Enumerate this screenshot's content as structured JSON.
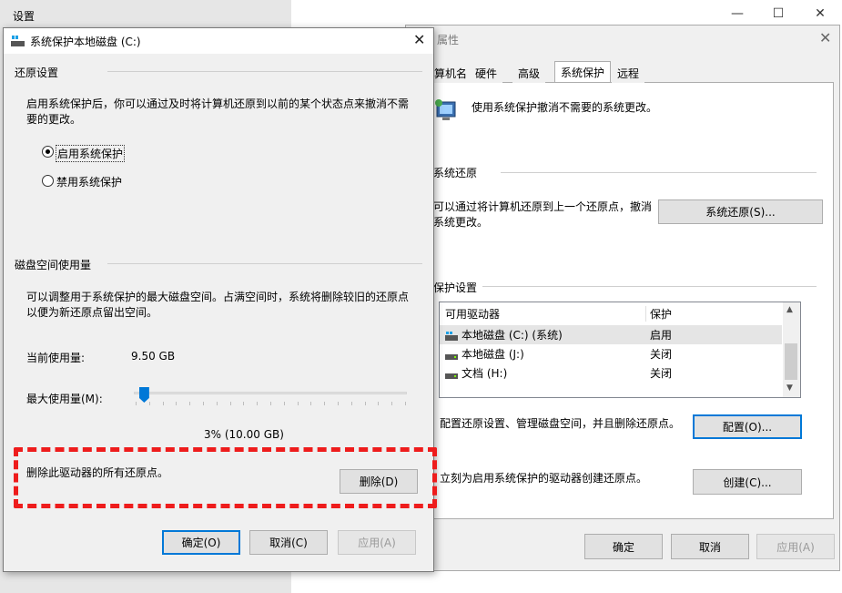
{
  "settings_window": {
    "title": "设置",
    "controls": {
      "minimize": "—",
      "maximize": "☐",
      "close": "✕"
    }
  },
  "sysprop": {
    "title": "属性",
    "tabs": [
      "算机名",
      "硬件",
      "高级",
      "系统保护",
      "远程"
    ],
    "active_tab": "系统保护",
    "intro": "使用系统保护撤消不需要的系统更改。",
    "restore_group": "系统还原",
    "restore_text_1": "可以通过将计算机还原到上一个还原点，撤消",
    "restore_text_2": "系统更改。",
    "restore_button": "系统还原(S)...",
    "protect_group": "保护设置",
    "drives_header": {
      "col1": "可用驱动器",
      "col2": "保护"
    },
    "drives": [
      {
        "name": "本地磁盘 (C:) (系统)",
        "status": "启用",
        "icon": "drive-system-icon"
      },
      {
        "name": "本地磁盘 (J:)",
        "status": "关闭",
        "icon": "drive-icon"
      },
      {
        "name": "文档 (H:)",
        "status": "关闭",
        "icon": "drive-icon"
      }
    ],
    "config_text": "配置还原设置、管理磁盘空间，并且删除还原点。",
    "config_button": "配置(O)...",
    "create_text": "立刻为启用系统保护的驱动器创建还原点。",
    "create_button": "创建(C)...",
    "ok": "确定",
    "cancel": "取消",
    "apply": "应用(A)"
  },
  "dialog": {
    "title": "系统保护本地磁盘 (C:)",
    "restore_section": "还原设置",
    "restore_desc_1": "启用系统保护后，你可以通过及时将计算机还原到以前的某个状态点来撤消不需",
    "restore_desc_2": "要的更改。",
    "radio_enable": "启用系统保护",
    "radio_disable": "禁用系统保护",
    "disk_section": "磁盘空间使用量",
    "disk_desc_1": "可以调整用于系统保护的最大磁盘空间。占满空间时，系统将删除较旧的还原点",
    "disk_desc_2": "以便为新还原点留出空间。",
    "current_label": "当前使用量:",
    "current_value": "9.50 GB",
    "max_label": "最大使用量(M):",
    "max_value": "3% (10.00 GB)",
    "slider_percent": 3,
    "delete_text": "删除此驱动器的所有还原点。",
    "delete_button": "删除(D)",
    "ok": "确定(O)",
    "cancel": "取消(C)",
    "apply": "应用(A)"
  },
  "colors": {
    "accent": "#0078d7",
    "highlight": "#ee1c1c"
  }
}
